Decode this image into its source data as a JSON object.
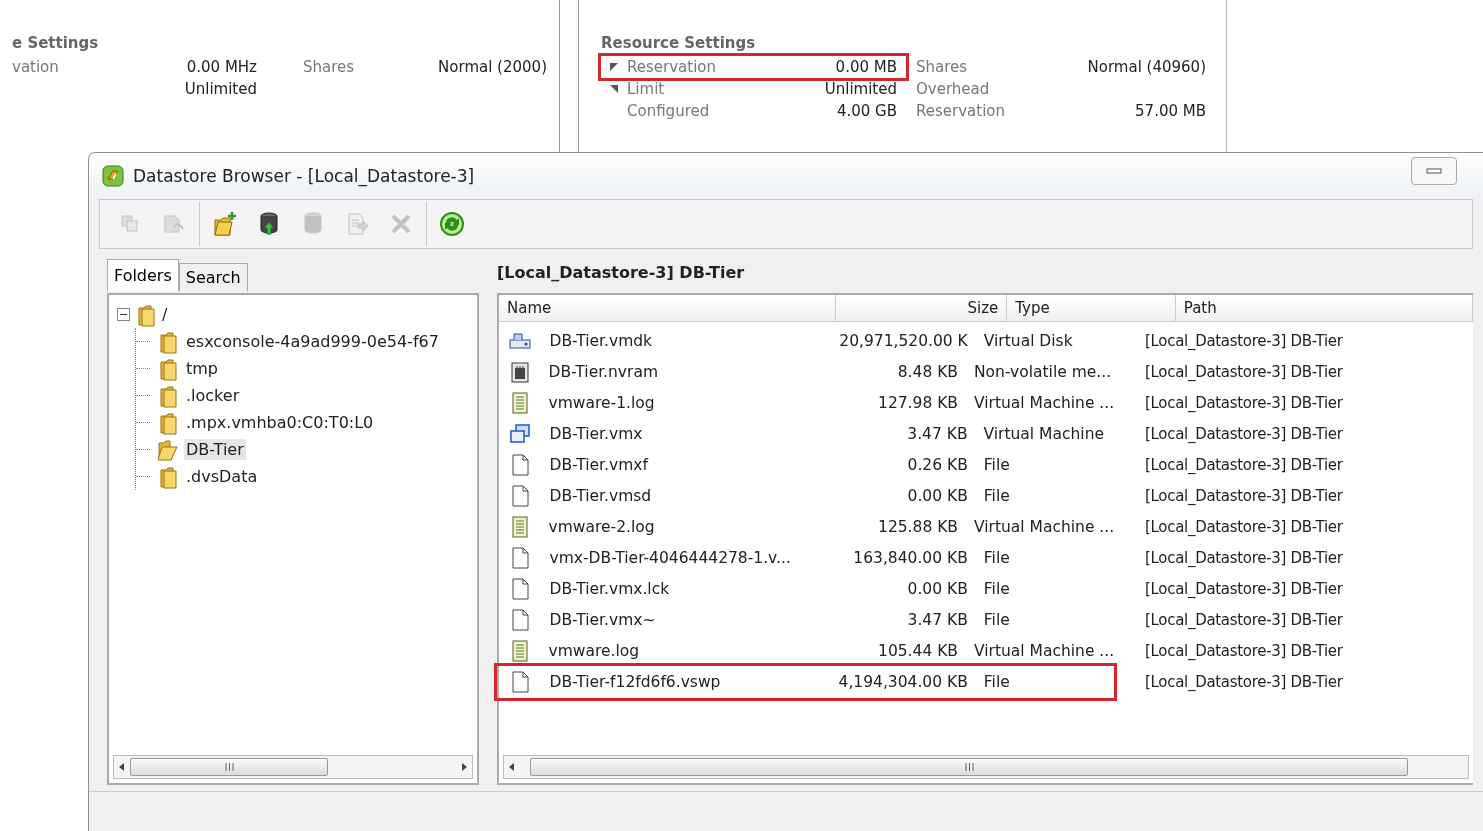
{
  "background": {
    "left_panel": {
      "heading": "e Settings",
      "fields": [
        {
          "label": "vation",
          "value": "0.00 MHz",
          "value_2": "Unlimited",
          "label_2": "Shares",
          "value_3": "Normal (2000)"
        }
      ]
    },
    "right_panel": {
      "heading": "Resource Settings",
      "rows": [
        {
          "marker": true,
          "label": "Reservation",
          "value": "0.00 MB",
          "label_2": "Shares",
          "value_2": "Normal (40960)",
          "highlighted": true
        },
        {
          "marker": true,
          "label": "Limit",
          "value": "Unlimited",
          "label_2": "Overhead",
          "value_2": "",
          "highlighted": false
        },
        {
          "marker": false,
          "label": "Configured",
          "value": "4.00 GB",
          "label_2": "Reservation",
          "value_2": "57.00 MB",
          "highlighted": false
        }
      ]
    }
  },
  "window": {
    "title": "Datastore Browser - [Local_Datastore-3]"
  },
  "toolbar": {
    "buttons": [
      {
        "kind": "copy",
        "disabled": true
      },
      {
        "kind": "back",
        "disabled": true
      },
      {
        "kind": "new-folder",
        "disabled": false
      },
      {
        "kind": "upload",
        "disabled": false
      },
      {
        "kind": "download",
        "disabled": true
      },
      {
        "kind": "move",
        "disabled": true
      },
      {
        "kind": "delete",
        "disabled": true
      },
      {
        "kind": "refresh",
        "disabled": false
      }
    ]
  },
  "tabs": [
    {
      "label": "Folders",
      "selected": true
    },
    {
      "label": "Search",
      "selected": false
    }
  ],
  "tree": [
    {
      "label": "/",
      "expanded": true,
      "selected": false,
      "children": [
        {
          "label": "esxconsole-4a9ad999-0e54-f67",
          "selected": false
        },
        {
          "label": "tmp",
          "selected": false
        },
        {
          "label": ".locker",
          "selected": false
        },
        {
          "label": ".mpx.vmhba0:C0:T0:L0",
          "selected": false
        },
        {
          "label": "DB-Tier",
          "selected": true
        },
        {
          "label": ".dvsData",
          "selected": false
        }
      ]
    }
  ],
  "path_header": "[Local_Datastore-3] DB-Tier",
  "table": {
    "columns": [
      "Name",
      "Size",
      "Type",
      "Path"
    ],
    "rows": [
      {
        "kind": "disk",
        "name": "DB-Tier.vmdk",
        "size": "20,971,520.00 K",
        "type": "Virtual Disk",
        "path": "[Local_Datastore-3] DB-Tier",
        "highlighted": false
      },
      {
        "kind": "nvram",
        "name": "DB-Tier.nvram",
        "size": "8.48 KB",
        "type": "Non-volatile me...",
        "path": "[Local_Datastore-3] DB-Tier",
        "highlighted": false
      },
      {
        "kind": "log",
        "name": "vmware-1.log",
        "size": "127.98 KB",
        "type": "Virtual Machine ...",
        "path": "[Local_Datastore-3] DB-Tier",
        "highlighted": false
      },
      {
        "kind": "vmx",
        "name": "DB-Tier.vmx",
        "size": "3.47 KB",
        "type": "Virtual Machine",
        "path": "[Local_Datastore-3] DB-Tier",
        "highlighted": false
      },
      {
        "kind": "file",
        "name": "DB-Tier.vmxf",
        "size": "0.26 KB",
        "type": "File",
        "path": "[Local_Datastore-3] DB-Tier",
        "highlighted": false
      },
      {
        "kind": "file",
        "name": "DB-Tier.vmsd",
        "size": "0.00 KB",
        "type": "File",
        "path": "[Local_Datastore-3] DB-Tier",
        "highlighted": false
      },
      {
        "kind": "log",
        "name": "vmware-2.log",
        "size": "125.88 KB",
        "type": "Virtual Machine ...",
        "path": "[Local_Datastore-3] DB-Tier",
        "highlighted": false
      },
      {
        "kind": "file",
        "name": "vmx-DB-Tier-4046444278-1.v...",
        "size": "163,840.00 KB",
        "type": "File",
        "path": "[Local_Datastore-3] DB-Tier",
        "highlighted": false
      },
      {
        "kind": "file",
        "name": "DB-Tier.vmx.lck",
        "size": "0.00 KB",
        "type": "File",
        "path": "[Local_Datastore-3] DB-Tier",
        "highlighted": false
      },
      {
        "kind": "file",
        "name": "DB-Tier.vmx~",
        "size": "3.47 KB",
        "type": "File",
        "path": "[Local_Datastore-3] DB-Tier",
        "highlighted": false
      },
      {
        "kind": "log",
        "name": "vmware.log",
        "size": "105.44 KB",
        "type": "Virtual Machine ...",
        "path": "[Local_Datastore-3] DB-Tier",
        "highlighted": false
      },
      {
        "kind": "file",
        "name": "DB-Tier-f12fd6f6.vswp",
        "size": "4,194,304.00 KB",
        "type": "File",
        "path": "[Local_Datastore-3] DB-Tier",
        "highlighted": true
      }
    ]
  }
}
